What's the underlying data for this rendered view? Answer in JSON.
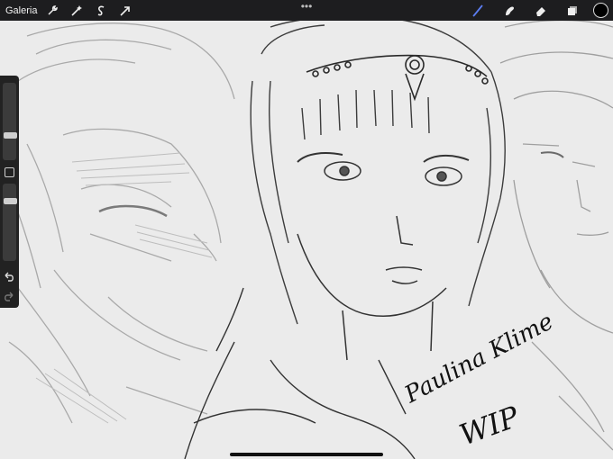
{
  "topbar": {
    "gallery_label": "Galeria",
    "more_label": "•••",
    "left_tools": [
      "wrench-icon",
      "magic-wand-icon",
      "selection-icon",
      "transform-arrow-icon"
    ],
    "right_tools": [
      "brush-icon",
      "smudge-icon",
      "eraser-icon",
      "layers-icon"
    ],
    "active_tool": "brush-icon",
    "active_color": "#5b7cf0",
    "current_color": "#000000"
  },
  "sidebar": {
    "brush_size": 0.3,
    "brush_opacity": 0.2,
    "modify_icon": "square-icon",
    "undo_icon": "undo-arrow-icon",
    "redo_icon": "redo-arrow-icon"
  },
  "canvas": {
    "signature_line1": "Paulina Klime",
    "signature_line2": "WIP"
  }
}
